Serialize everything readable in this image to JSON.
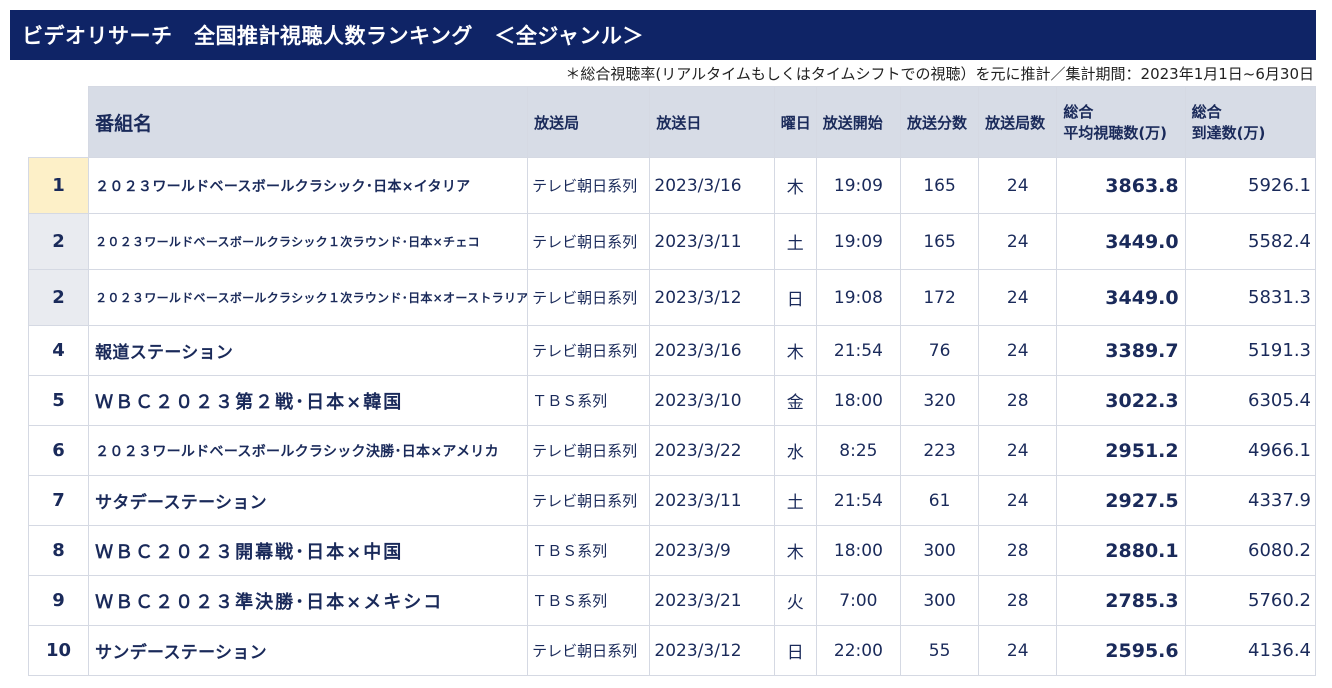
{
  "title": "ビデオリサーチ　全国推計視聴人数ランキング　＜全ジャンル＞",
  "note": "＊総合視聴率(リアルタイムもしくはタイムシフトでの視聴）を元に推計／集計期間：2023年1月1日~6月30日",
  "headers": {
    "program": "番組名",
    "station": "放送局",
    "date": "放送日",
    "weekday": "曜日",
    "start": "放送開始",
    "minutes": "放送分数",
    "stations_count": "放送局数",
    "rating_line1": "総合",
    "rating_line2": "平均視聴数(万)",
    "reach_line1": "総合",
    "reach_line2": "到達数(万)"
  },
  "rows": [
    {
      "rank": "1",
      "program": "２０２３ワールドベースボールクラシック･日本×イタリア",
      "station": "テレビ朝日系列",
      "date": "2023/3/16",
      "weekday": "木",
      "start": "19:09",
      "minutes": "165",
      "stations": "24",
      "rating": "3863.8",
      "reach": "5926.1"
    },
    {
      "rank": "2",
      "program": "２０２３ワールドベースボールクラシック１次ラウンド･日本×チェコ",
      "station": "テレビ朝日系列",
      "date": "2023/3/11",
      "weekday": "土",
      "start": "19:09",
      "minutes": "165",
      "stations": "24",
      "rating": "3449.0",
      "reach": "5582.4"
    },
    {
      "rank": "2",
      "program": "２０２３ワールドベースボールクラシック１次ラウンド･日本×オーストラリア",
      "station": "テレビ朝日系列",
      "date": "2023/3/12",
      "weekday": "日",
      "start": "19:08",
      "minutes": "172",
      "stations": "24",
      "rating": "3449.0",
      "reach": "5831.3"
    },
    {
      "rank": "4",
      "program": "報道ステーション",
      "station": "テレビ朝日系列",
      "date": "2023/3/16",
      "weekday": "木",
      "start": "21:54",
      "minutes": "76",
      "stations": "24",
      "rating": "3389.7",
      "reach": "5191.3"
    },
    {
      "rank": "5",
      "program": "ＷＢＣ２０２３第２戦･日本×韓国",
      "station": "ＴＢＳ系列",
      "date": "2023/3/10",
      "weekday": "金",
      "start": "18:00",
      "minutes": "320",
      "stations": "28",
      "rating": "3022.3",
      "reach": "6305.4"
    },
    {
      "rank": "6",
      "program": "２０２３ワールドベースボールクラシック決勝･日本×アメリカ",
      "station": "テレビ朝日系列",
      "date": "2023/3/22",
      "weekday": "水",
      "start": "8:25",
      "minutes": "223",
      "stations": "24",
      "rating": "2951.2",
      "reach": "4966.1"
    },
    {
      "rank": "7",
      "program": "サタデーステーション",
      "station": "テレビ朝日系列",
      "date": "2023/3/11",
      "weekday": "土",
      "start": "21:54",
      "minutes": "61",
      "stations": "24",
      "rating": "2927.5",
      "reach": "4337.9"
    },
    {
      "rank": "8",
      "program": "ＷＢＣ２０２３開幕戦･日本×中国",
      "station": "ＴＢＳ系列",
      "date": "2023/3/9",
      "weekday": "木",
      "start": "18:00",
      "minutes": "300",
      "stations": "28",
      "rating": "2880.1",
      "reach": "6080.2"
    },
    {
      "rank": "9",
      "program": "ＷＢＣ２０２３準決勝･日本×メキシコ",
      "station": "ＴＢＳ系列",
      "date": "2023/3/21",
      "weekday": "火",
      "start": "7:00",
      "minutes": "300",
      "stations": "28",
      "rating": "2785.3",
      "reach": "5760.2"
    },
    {
      "rank": "10",
      "program": "サンデーステーション",
      "station": "テレビ朝日系列",
      "date": "2023/3/12",
      "weekday": "日",
      "start": "22:00",
      "minutes": "55",
      "stations": "24",
      "rating": "2595.6",
      "reach": "4136.4"
    }
  ],
  "colors": {
    "title_bg": "#0f2466",
    "header_bg": "#d7dce6",
    "rank1_bg": "#fdf0c8",
    "rank2_bg": "#e9ebf0"
  }
}
